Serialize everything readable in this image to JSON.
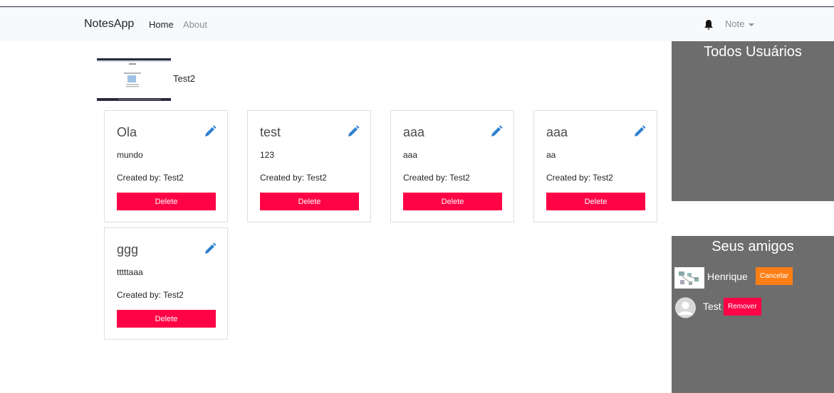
{
  "navbar": {
    "brand": "NotesApp",
    "links": [
      "Home",
      "About"
    ],
    "notification_icon": "bell-icon",
    "dropdown_label": "Note"
  },
  "profile": {
    "username": "Test2"
  },
  "notes": [
    {
      "title": "Ola",
      "body": "mundo",
      "created_by": "Created by: Test2",
      "delete_label": "Delete"
    },
    {
      "title": "test",
      "body": "123",
      "created_by": "Created by: Test2",
      "delete_label": "Delete"
    },
    {
      "title": "aaa",
      "body": "aaa",
      "created_by": "Created by: Test2",
      "delete_label": "Delete"
    },
    {
      "title": "aaa",
      "body": "aa",
      "created_by": "Created by: Test2",
      "delete_label": "Delete"
    },
    {
      "title": "ggg",
      "body": "tttttaaa",
      "created_by": "Created by: Test2",
      "delete_label": "Delete"
    }
  ],
  "all_users": {
    "title": "Todos Usuários"
  },
  "friends": {
    "title": "Seus amigos",
    "list": [
      {
        "name": "Henrique",
        "action": "Cancelar"
      },
      {
        "name": "Test",
        "action": "Remover"
      }
    ]
  },
  "colors": {
    "delete": "#ff0346",
    "cancel": "#fd7e14",
    "panel": "#6d6d6d",
    "edit_icon": "#2f80d1"
  }
}
